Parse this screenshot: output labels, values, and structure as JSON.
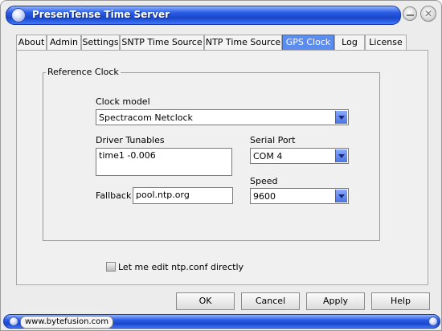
{
  "window": {
    "title": "PresenTense Time Server"
  },
  "tabs": [
    {
      "label": "About"
    },
    {
      "label": "Admin"
    },
    {
      "label": "Settings"
    },
    {
      "label": "SNTP Time Source"
    },
    {
      "label": "NTP Time Source"
    },
    {
      "label": "GPS Clock",
      "active": true
    },
    {
      "label": "Log"
    },
    {
      "label": "License"
    }
  ],
  "reference_clock": {
    "group_label": "Reference Clock",
    "clock_model": {
      "label": "Clock model",
      "value": "Spectracom Netclock"
    },
    "driver_tunables": {
      "label": "Driver  Tunables",
      "value": "time1 -0.006"
    },
    "serial_port": {
      "label": "Serial Port",
      "value": "COM 4"
    },
    "speed": {
      "label": "Speed",
      "value": "9600"
    },
    "fallback": {
      "label": "Fallback",
      "value": "pool.ntp.org"
    }
  },
  "edit_ntp_conf": {
    "label": "Let me edit ntp.conf directly",
    "checked": false
  },
  "buttons": {
    "ok": "OK",
    "cancel": "Cancel",
    "apply": "Apply",
    "help": "Help"
  },
  "statusbar": {
    "link": "www.bytefusion.com"
  },
  "colors": {
    "titlebar": "#2a5ce6",
    "active_tab": "#5b8cf0",
    "dropdown": "#4b72e0"
  }
}
